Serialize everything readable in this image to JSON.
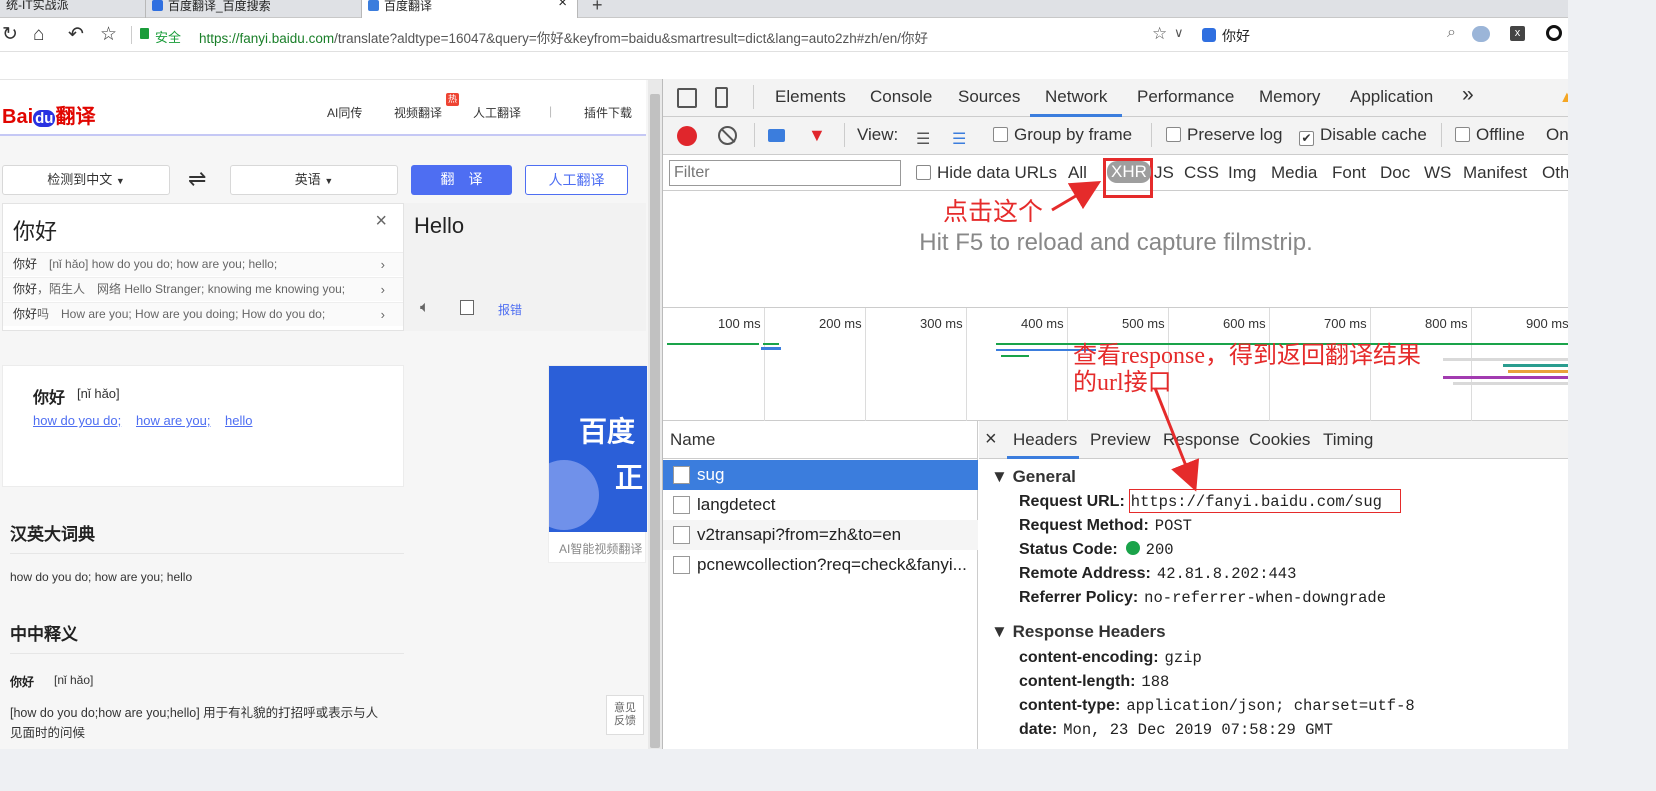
{
  "tabs": [
    {
      "label": "统-IT实战派",
      "active": false
    },
    {
      "label": "百度翻译_百度搜索",
      "active": false
    },
    {
      "label": "百度翻译",
      "active": true
    }
  ],
  "tab_close": "×",
  "tab_new": "+",
  "address": {
    "secure": "安全",
    "url_host": "https://fanyi.baidu.com",
    "url_rest": "/translate?aldtype=16047&query=你好&keyfrom=baidu&smartresult=dict&lang=auto2zh#zh/en/你好",
    "search_text": "你好"
  },
  "baidu": {
    "logo_bai": "Bai",
    "logo_du": "du",
    "logo_fanyi": "翻译",
    "nav": [
      "AI同传",
      "视频翻译",
      "人工翻译",
      "|",
      "插件下载"
    ],
    "hot_badge": "热",
    "src_lang": "检测到中文",
    "swap": "⇌",
    "tgt_lang": "英语",
    "translate_btn": "翻　译",
    "human_btn": "人工翻译",
    "input_text": "你好",
    "output_text": "Hello",
    "report": "报错",
    "suggestions": [
      {
        "word": "你好",
        "desc": "[nǐ hǎo] how do you do; how are you; hello;"
      },
      {
        "word": "你好",
        "desc": "，陌生人　网络 Hello Stranger; knowing me knowing you;"
      },
      {
        "word": "你好",
        "desc": "吗　How are you; How are you doing; How do you do;"
      }
    ],
    "card_word": "你好",
    "card_phon": "[nǐ hǎo]",
    "card_links": [
      "how do you do;",
      "how are you;",
      "hello"
    ],
    "ad_text1": "百度",
    "ad_text2": "正",
    "ad_caption": "AI智能视频翻译",
    "dict_title": "汉英大词典",
    "dict_text": "how do you do; how are you; hello",
    "zh_title": "中中释义",
    "zh_word": "你好",
    "zh_phon": "[nǐ hǎo]",
    "zh_def1": "[how do you do;how are you;hello] 用于有礼貌的打招呼或表示与人",
    "zh_def2": "见面时的问候",
    "feedback": "意见\n反馈"
  },
  "devtools": {
    "tabs": [
      "Elements",
      "Console",
      "Sources",
      "Network",
      "Performance",
      "Memory",
      "Application"
    ],
    "more": "»",
    "active_tab": "Network",
    "toolbar": {
      "view": "View:",
      "group": "Group by frame",
      "preserve": "Preserve log",
      "disable_cache": "Disable cache",
      "offline": "Offline",
      "online": "On"
    },
    "filter_placeholder": "Filter",
    "hide_urls": "Hide data URLs",
    "types": [
      "All",
      "XHR",
      "JS",
      "CSS",
      "Img",
      "Media",
      "Font",
      "Doc",
      "WS",
      "Manifest",
      "Oth"
    ],
    "filmstrip_msg": "Hit F5 to reload and capture filmstrip.",
    "ticks": [
      "100 ms",
      "200 ms",
      "300 ms",
      "400 ms",
      "500 ms",
      "600 ms",
      "700 ms",
      "800 ms",
      "900 ms"
    ],
    "list_header": "Name",
    "requests": [
      "sug",
      "langdetect",
      "v2transapi?from=zh&to=en",
      "pcnewcollection?req=check&fanyi..."
    ],
    "detail_close": "×",
    "detail_tabs": [
      "Headers",
      "Preview",
      "Response",
      "Cookies",
      "Timing"
    ],
    "general_title": "General",
    "general": [
      {
        "k": "Request URL:",
        "v": "https://fanyi.baidu.com/sug"
      },
      {
        "k": "Request Method:",
        "v": "POST"
      },
      {
        "k": "Status Code:",
        "v": "200"
      },
      {
        "k": "Remote Address:",
        "v": "42.81.8.202:443"
      },
      {
        "k": "Referrer Policy:",
        "v": "no-referrer-when-downgrade"
      }
    ],
    "response_title": "Response Headers",
    "response": [
      {
        "k": "content-encoding:",
        "v": "gzip"
      },
      {
        "k": "content-length:",
        "v": "188"
      },
      {
        "k": "content-type:",
        "v": "application/json; charset=utf-8"
      },
      {
        "k": "date:",
        "v": "Mon, 23 Dec 2019 07:58:29 GMT"
      }
    ]
  },
  "annotations": {
    "click_this": "点击这个",
    "response_note_1": "查看response，得到返回翻译结果",
    "response_note_2": "的url接口"
  },
  "colors": {
    "accent": "#3b7ddd",
    "baidu_blue": "#4e6ef2",
    "annotation_red": "#e52b2b",
    "status_green": "#1aa34a"
  }
}
